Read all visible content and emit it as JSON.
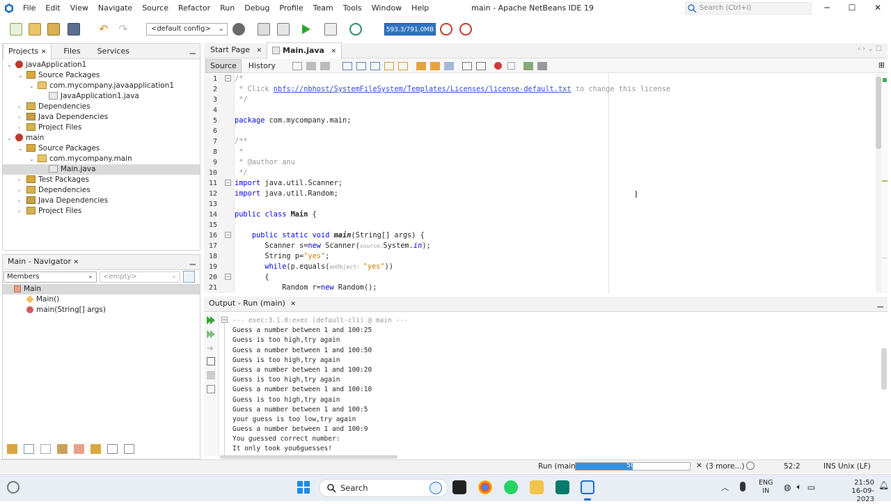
{
  "window": {
    "title": "main - Apache NetBeans IDE 19",
    "search_placeholder": "Search (Ctrl+I)",
    "menu": [
      "File",
      "Edit",
      "View",
      "Navigate",
      "Source",
      "Refactor",
      "Run",
      "Debug",
      "Profile",
      "Team",
      "Tools",
      "Window",
      "Help"
    ]
  },
  "toolbar": {
    "config": "<default config>",
    "memory": "593.3/791.0MB"
  },
  "projects_panel": {
    "tabs": [
      "Projects",
      "Files",
      "Services"
    ],
    "tree": [
      {
        "label": "javaApplication1",
        "type": "project",
        "level": 0,
        "exp": "⌄"
      },
      {
        "label": "Source Packages",
        "type": "pkgfolder",
        "level": 1,
        "exp": "⌄"
      },
      {
        "label": "com.mycompany.javaapplication1",
        "type": "pkg",
        "level": 2,
        "exp": "⌄"
      },
      {
        "label": "JavaApplication1.java",
        "type": "java",
        "level": 3,
        "exp": ""
      },
      {
        "label": "Dependencies",
        "type": "folder",
        "level": 1,
        "exp": "›"
      },
      {
        "label": "Java Dependencies",
        "type": "lib",
        "level": 1,
        "exp": "›"
      },
      {
        "label": "Project Files",
        "type": "folder",
        "level": 1,
        "exp": "›"
      },
      {
        "label": "main",
        "type": "project",
        "level": 0,
        "exp": "⌄"
      },
      {
        "label": "Source Packages",
        "type": "pkgfolder",
        "level": 1,
        "exp": "⌄"
      },
      {
        "label": "com.mycompany.main",
        "type": "pkg",
        "level": 2,
        "exp": "⌄"
      },
      {
        "label": "Main.java",
        "type": "java",
        "level": 3,
        "exp": "",
        "selected": true
      },
      {
        "label": "Test Packages",
        "type": "pkgfolder",
        "level": 1,
        "exp": "›"
      },
      {
        "label": "Dependencies",
        "type": "folder",
        "level": 1,
        "exp": "›"
      },
      {
        "label": "Java Dependencies",
        "type": "lib",
        "level": 1,
        "exp": "›"
      },
      {
        "label": "Project Files",
        "type": "folder",
        "level": 1,
        "exp": "›"
      }
    ]
  },
  "navigator": {
    "title": "Main - Navigator",
    "members": "Members",
    "empty": "<empty>",
    "items": [
      {
        "label": "Main",
        "kind": "class"
      },
      {
        "label": "Main()",
        "kind": "constructor"
      },
      {
        "label": "main(String[] args)",
        "kind": "method"
      }
    ]
  },
  "editor": {
    "tabs": [
      "Start Page",
      "Main.java"
    ],
    "subtabs": [
      "Source",
      "History"
    ],
    "lines": [
      [
        [
          "cm",
          "/*"
        ]
      ],
      [
        [
          "cm",
          " * Click "
        ],
        [
          "link",
          "nbfs://nbhost/SystemFileSystem/Templates/Licenses/license-default.txt"
        ],
        [
          "cm",
          " to change this license"
        ]
      ],
      [
        [
          "cm",
          " */"
        ]
      ],
      [
        [
          "",
          ""
        ]
      ],
      [
        [
          "kw",
          "package"
        ],
        [
          "",
          " com.mycompany.main;"
        ]
      ],
      [
        [
          "",
          ""
        ]
      ],
      [
        [
          "cm",
          "/**"
        ]
      ],
      [
        [
          "cm",
          " *"
        ]
      ],
      [
        [
          "cm",
          " * @author anu"
        ]
      ],
      [
        [
          "cm",
          " */"
        ]
      ],
      [
        [
          "kw",
          "import"
        ],
        [
          "",
          " java.util.Scanner;"
        ]
      ],
      [
        [
          "kw",
          "import"
        ],
        [
          "",
          " java.util.Random;"
        ]
      ],
      [
        [
          "",
          ""
        ]
      ],
      [
        [
          "kw",
          "public class"
        ],
        [
          "",
          " "
        ],
        [
          "b",
          "Main"
        ],
        [
          "",
          " {"
        ]
      ],
      [
        [
          "",
          ""
        ]
      ],
      [
        [
          "",
          "    "
        ],
        [
          "kw",
          "public static void"
        ],
        [
          "",
          " "
        ],
        [
          "bi",
          "main"
        ],
        [
          "",
          "(String[] args) {"
        ]
      ],
      [
        [
          "",
          "       Scanner s="
        ],
        [
          "kw",
          "new"
        ],
        [
          "",
          " Scanner("
        ],
        [
          "hint",
          "source:"
        ],
        [
          "",
          "System."
        ],
        [
          "i",
          "in"
        ],
        [
          "",
          ");"
        ]
      ],
      [
        [
          "",
          "       String p="
        ],
        [
          "st",
          "\"yes\""
        ],
        [
          "",
          ";"
        ]
      ],
      [
        [
          "",
          "       "
        ],
        [
          "kw",
          "while"
        ],
        [
          "",
          "(p.equals("
        ],
        [
          "hint",
          "anObject: "
        ],
        [
          "st",
          "\"yes\""
        ],
        [
          "",
          "))"
        ]
      ],
      [
        [
          "",
          "       {"
        ]
      ],
      [
        [
          "",
          "           Random r="
        ],
        [
          "kw",
          "new"
        ],
        [
          "",
          " Random();"
        ]
      ]
    ]
  },
  "output": {
    "title": "Output - Run (main)",
    "lines": [
      "--- exec:3.1.0:exec (default-cli) @ main ---",
      "Guess a number between 1 and 100:25",
      "Guess is too high,try again",
      "Guess a number between 1 and 100:50",
      "Guess is too high,try again",
      "Guess a number between 1 and 100:20",
      "Guess is too high,try again",
      "Guess a number between 1 and 100:10",
      "Guess is too high,try again",
      "Guess a number between 1 and 100:5",
      "your guess is too low,try again",
      "Guess a number between 1 and 100:9",
      "You guessed correct number:",
      "It only took you6guesses!"
    ]
  },
  "status": {
    "run_label": "Run (main)",
    "progress_pct": 50,
    "progress_text": "50%",
    "more": "(3 more...)",
    "position": "52:2",
    "mode": "INS",
    "line_ending": "Unix (LF)"
  },
  "taskbar": {
    "search": "Search",
    "lang1": "ENG",
    "lang2": "IN",
    "time": "21:50",
    "date": "16-09-2023"
  }
}
